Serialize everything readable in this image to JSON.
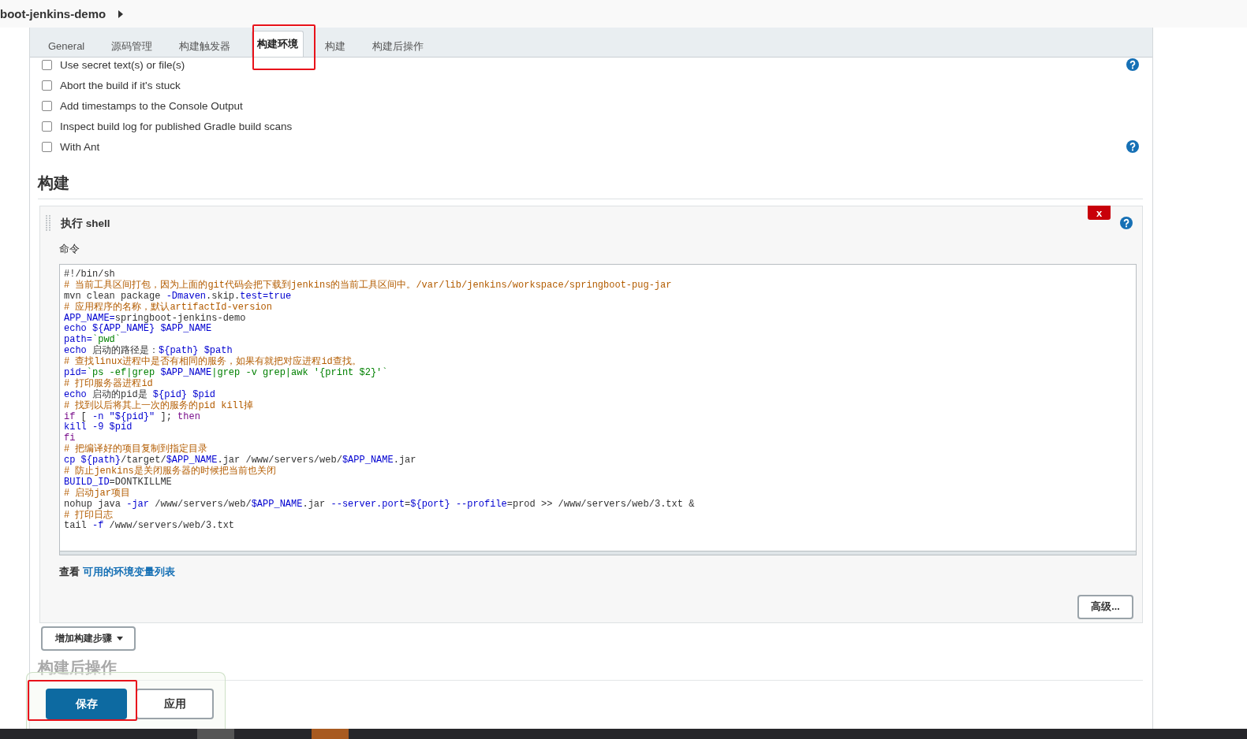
{
  "breadcrumb": {
    "label": "boot-jenkins-demo"
  },
  "tabs": [
    {
      "label": "General",
      "selected": false
    },
    {
      "label": "源码管理",
      "selected": false
    },
    {
      "label": "构建触发器",
      "selected": false
    },
    {
      "label": "构建环境",
      "selected": true
    },
    {
      "label": "构建",
      "selected": false
    },
    {
      "label": "构建后操作",
      "selected": false
    }
  ],
  "options": [
    {
      "label": "Use secret text(s) or file(s)",
      "checked": false,
      "help": true
    },
    {
      "label": "Abort the build if it's stuck",
      "checked": false,
      "help": false
    },
    {
      "label": "Add timestamps to the Console Output",
      "checked": false,
      "help": false
    },
    {
      "label": "Inspect build log for published Gradle build scans",
      "checked": false,
      "help": false
    },
    {
      "label": "With Ant",
      "checked": false,
      "help": true
    }
  ],
  "build_section": {
    "title": "构建",
    "step": {
      "title": "执行 shell",
      "delete_label": "x",
      "command_label": "命令",
      "code_lines": [
        [
          {
            "text": "#!/bin/sh",
            "kind": "plain"
          }
        ],
        [
          {
            "text": "# 当前工具区间打包，因为上面的git代码会把下载到jenkins的当前工具区间中。/var/lib/jenkins/workspace/springboot-pug-jar",
            "kind": "comment"
          }
        ],
        [
          {
            "text": "mvn clean package ",
            "kind": "plain"
          },
          {
            "text": "-Dmaven",
            "kind": "var"
          },
          {
            "text": ".skip.",
            "kind": "plain"
          },
          {
            "text": "test=true",
            "kind": "var"
          }
        ],
        [
          {
            "text": "# 应用程序的名称，默认artifactId-version",
            "kind": "comment"
          }
        ],
        [
          {
            "text": "APP_NAME=",
            "kind": "var"
          },
          {
            "text": "springboot-jenkins-demo",
            "kind": "plain"
          }
        ],
        [
          {
            "text": "echo ${APP_NAME} $APP_NAME",
            "kind": "var"
          }
        ],
        [
          {
            "text": "path=",
            "kind": "var"
          },
          {
            "text": "`pwd`",
            "kind": "string"
          }
        ],
        [
          {
            "text": "echo",
            "kind": "var"
          },
          {
            "text": " 启动的路径是：",
            "kind": "plain"
          },
          {
            "text": "${path} $path",
            "kind": "var"
          }
        ],
        [
          {
            "text": "# 查找linux进程中是否有相同的服务，如果有就把对应进程id查找。",
            "kind": "comment"
          }
        ],
        [
          {
            "text": "pid=",
            "kind": "var"
          },
          {
            "text": "`ps -ef|grep ",
            "kind": "string"
          },
          {
            "text": "$APP_NAME",
            "kind": "var"
          },
          {
            "text": "|grep -v grep|awk '{print $2}'`",
            "kind": "string"
          }
        ],
        [
          {
            "text": "# 打印服务器进程id",
            "kind": "comment"
          }
        ],
        [
          {
            "text": "echo",
            "kind": "var"
          },
          {
            "text": " 启动的pid是 ",
            "kind": "plain"
          },
          {
            "text": "${pid} $pid",
            "kind": "var"
          }
        ],
        [
          {
            "text": "# 找到以后将其上一次的服务的pid kill掉",
            "kind": "comment"
          }
        ],
        [
          {
            "text": "if",
            "kind": "keyword"
          },
          {
            "text": " [ ",
            "kind": "plain"
          },
          {
            "text": "-n \"${pid}\"",
            "kind": "var"
          },
          {
            "text": " ]; ",
            "kind": "plain"
          },
          {
            "text": "then",
            "kind": "keyword"
          }
        ],
        [
          {
            "text": "kill -9 $pid",
            "kind": "var"
          }
        ],
        [
          {
            "text": "fi",
            "kind": "keyword"
          }
        ],
        [
          {
            "text": "# 把编译好的项目复制到指定目录",
            "kind": "comment"
          }
        ],
        [
          {
            "text": "cp ${path}",
            "kind": "var"
          },
          {
            "text": "/target/",
            "kind": "plain"
          },
          {
            "text": "$APP_NAME",
            "kind": "var"
          },
          {
            "text": ".jar /www/servers/web/",
            "kind": "plain"
          },
          {
            "text": "$APP_NAME",
            "kind": "var"
          },
          {
            "text": ".jar",
            "kind": "plain"
          }
        ],
        [
          {
            "text": "# 防止jenkins是关闭服务器的时候把当前也关闭",
            "kind": "comment"
          }
        ],
        [
          {
            "text": "BUILD_ID",
            "kind": "var"
          },
          {
            "text": "=DONTKILLME",
            "kind": "plain"
          }
        ],
        [
          {
            "text": "# 启动jar项目",
            "kind": "comment"
          }
        ],
        [
          {
            "text": "nohup java ",
            "kind": "plain"
          },
          {
            "text": "-jar",
            "kind": "var"
          },
          {
            "text": " /www/servers/web/",
            "kind": "plain"
          },
          {
            "text": "$APP_NAME",
            "kind": "var"
          },
          {
            "text": ".jar ",
            "kind": "plain"
          },
          {
            "text": "--server.port",
            "kind": "var"
          },
          {
            "text": "=",
            "kind": "plain"
          },
          {
            "text": "${port} --profile",
            "kind": "var"
          },
          {
            "text": "=prod >> /www/servers/web/3.txt &",
            "kind": "plain"
          }
        ],
        [
          {
            "text": "# 打印日志",
            "kind": "comment"
          }
        ],
        [
          {
            "text": "tail ",
            "kind": "plain"
          },
          {
            "text": "-f",
            "kind": "var"
          },
          {
            "text": " /www/servers/web/3.txt",
            "kind": "plain"
          }
        ]
      ],
      "env_hint": {
        "prefix": "查看",
        "link": "可用的环境变量列表"
      },
      "advanced_button": "高级..."
    },
    "add_step_button": "增加构建步骤"
  },
  "post_build_section": {
    "title": "构建后操作"
  },
  "footer_buttons": [
    {
      "label": "保存",
      "kind": "primary"
    },
    {
      "label": "应用",
      "kind": "secondary"
    }
  ]
}
